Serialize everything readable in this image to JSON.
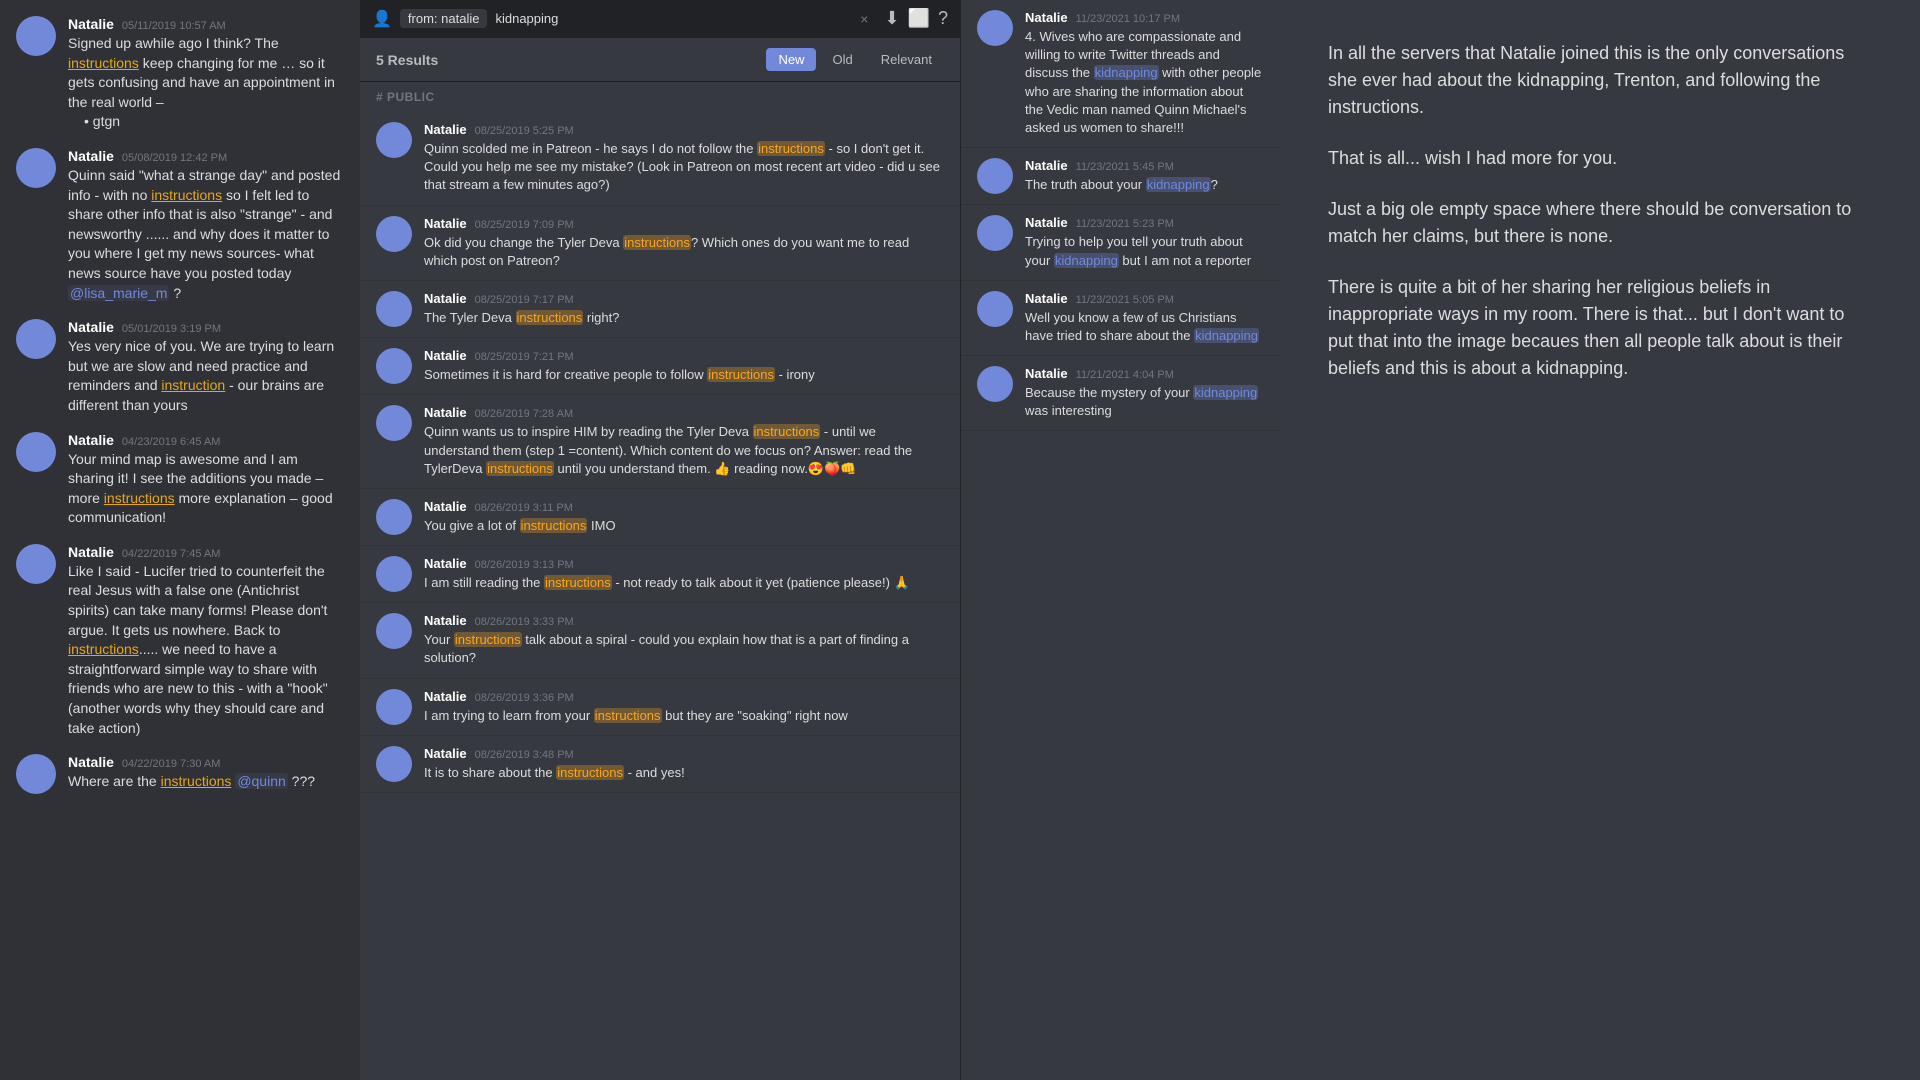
{
  "left_panel": {
    "messages": [
      {
        "id": "msg1",
        "username": "Natalie",
        "timestamp": "05/11/2019 10:57 AM",
        "text": "Signed up awhile ago I think?  The instructions keep changing for me … so it gets confusing and have an appointment in the real world –",
        "bullet": "gtgn",
        "highlight_words": [
          "instructions"
        ]
      },
      {
        "id": "msg2",
        "username": "Natalie",
        "timestamp": "05/08/2019 12:42 PM",
        "text": "Quinn said \"what a strange day\" and posted info - with no instructions so I felt led to share other info that is also \"strange\" - and newsworthy ...... and why does it matter to you where I get my news sources- what news source have you posted today @lisa_marie_m ?",
        "highlight_words": [
          "instructions"
        ]
      },
      {
        "id": "msg3",
        "username": "Natalie",
        "timestamp": "05/01/2019 3:19 PM",
        "text": "Yes very nice of you.  We are trying to learn but we are slow and need practice and reminders and instruction - our brains are different than yours",
        "highlight_words": [
          "instruction"
        ]
      },
      {
        "id": "msg4",
        "username": "Natalie",
        "timestamp": "04/23/2019 6:45 AM",
        "text": "Your mind map is awesome and I am sharing it!  I see the additions you made – more instructions more explanation – good communication!",
        "highlight_words": [
          "instructions"
        ]
      },
      {
        "id": "msg5",
        "username": "Natalie",
        "timestamp": "04/22/2019 7:45 AM",
        "text": "Like I said - Lucifer tried to counterfeit the real Jesus with a false one (Antichrist spirits) can take many forms!  Please don't argue.  It gets us nowhere.  Back to instructions..... we need to have a straightforward simple way to share with friends who are new to this - with a \"hook\" (another words why they should care and take action)",
        "highlight_words": [
          "instructions"
        ]
      },
      {
        "id": "msg6",
        "username": "Natalie",
        "timestamp": "04/22/2019 7:30 AM",
        "text": "Where are the instructions @quinn ???",
        "highlight_words": [
          "instructions"
        ]
      }
    ]
  },
  "search": {
    "from_label": "from: natalie",
    "keyword": "kidnapping",
    "results_count": "5 Results",
    "filters": [
      {
        "label": "New",
        "active": true
      },
      {
        "label": "Old",
        "active": false
      },
      {
        "label": "Relevant",
        "active": false
      }
    ],
    "channel_section": "# public",
    "close_icon": "×",
    "download_icon": "⬇",
    "screen_icon": "⬜",
    "help_icon": "?"
  },
  "search_results": [
    {
      "id": "r1",
      "username": "Natalie",
      "timestamp": "11/23/2021 10:17 PM",
      "text": "4. Wives who are compassionate and willing to write Twitter threads and discuss the kidnapping with other people who are sharing the information about the Vedic man named Quinn Michael's asked us women to share!!!",
      "keyword": "kidnapping"
    },
    {
      "id": "r2",
      "username": "Natalie",
      "timestamp": "11/23/2021 5:45 PM",
      "text": "The truth about your kidnapping?",
      "keyword": "kidnapping"
    },
    {
      "id": "r3",
      "username": "Natalie",
      "timestamp": "11/23/2021 5:23 PM",
      "text": "Trying to help you tell your truth about your kidnapping but I am not a reporter",
      "keyword": "kidnapping"
    },
    {
      "id": "r4",
      "username": "Natalie",
      "timestamp": "11/23/2021 5:05 PM",
      "text": "Well you know a few of us Christians have tried to share about the kidnapping",
      "keyword": "kidnapping"
    },
    {
      "id": "r5",
      "username": "Natalie",
      "timestamp": "11/21/2021 4:04 PM",
      "text": "Because the mystery of your kidnapping was interesting",
      "keyword": "kidnapping"
    }
  ],
  "left_search_results": [
    {
      "id": "ls1",
      "username": "Natalie",
      "timestamp": "08/25/2019 5:25 PM",
      "text_parts": [
        {
          "text": "Quinn scolded me in Patreon - he says I do not follow the ",
          "highlight": false
        },
        {
          "text": "instructions",
          "highlight": true,
          "color": "yellow"
        },
        {
          "text": " - so I don't get it.  Could you help me see my mistake? (Look in Patreon on most recent art video - did u see that stream a few minutes ago?)",
          "highlight": false
        }
      ]
    },
    {
      "id": "ls2",
      "username": "Natalie",
      "timestamp": "08/25/2019 7:09 PM",
      "text_parts": [
        {
          "text": "Ok did you change the Tyler Deva ",
          "highlight": false
        },
        {
          "text": "instructions",
          "highlight": true,
          "color": "yellow"
        },
        {
          "text": "? Which ones do you want me to read  which post on Patreon?",
          "highlight": false
        }
      ]
    },
    {
      "id": "ls3",
      "username": "Natalie",
      "timestamp": "08/25/2019 7:17 PM",
      "text_parts": [
        {
          "text": "The Tyler Deva ",
          "highlight": false
        },
        {
          "text": "instructions",
          "highlight": true,
          "color": "yellow"
        },
        {
          "text": " right?",
          "highlight": false
        }
      ]
    },
    {
      "id": "ls4",
      "username": "Natalie",
      "timestamp": "08/25/2019 7:21 PM",
      "text_parts": [
        {
          "text": "Sometimes it is hard for creative people to follow ",
          "highlight": false
        },
        {
          "text": "instructions",
          "highlight": true,
          "color": "yellow"
        },
        {
          "text": " - irony",
          "highlight": false
        }
      ]
    },
    {
      "id": "ls5",
      "username": "Natalie",
      "timestamp": "08/26/2019 7:28 AM",
      "text_parts": [
        {
          "text": "Quinn wants us to inspire HIM by reading the Tyler Deva ",
          "highlight": false
        },
        {
          "text": "instructions",
          "highlight": true,
          "color": "yellow"
        },
        {
          "text": " - until we understand them (step 1 =content). Which content do we focus on?  Answer: read the TylerDeva ",
          "highlight": false
        },
        {
          "text": "instructions",
          "highlight": true,
          "color": "yellow"
        },
        {
          "text": " until you understand them. 👍 reading now.😍🍑👊",
          "highlight": false
        }
      ]
    },
    {
      "id": "ls6",
      "username": "Natalie",
      "timestamp": "08/26/2019 3:11 PM",
      "text_parts": [
        {
          "text": "You give a lot of ",
          "highlight": false
        },
        {
          "text": "instructions",
          "highlight": true,
          "color": "yellow"
        },
        {
          "text": " IMO",
          "highlight": false
        }
      ]
    },
    {
      "id": "ls7",
      "username": "Natalie",
      "timestamp": "08/26/2019 3:13 PM",
      "text_parts": [
        {
          "text": "I am still reading the ",
          "highlight": false
        },
        {
          "text": "instructions",
          "highlight": true,
          "color": "yellow"
        },
        {
          "text": " - not ready to talk about it yet (patience please!) 🙏",
          "highlight": false
        }
      ]
    },
    {
      "id": "ls8",
      "username": "Natalie",
      "timestamp": "08/26/2019 3:33 PM",
      "text_parts": [
        {
          "text": "Your ",
          "highlight": false
        },
        {
          "text": "instructions",
          "highlight": true,
          "color": "yellow"
        },
        {
          "text": " talk about a spiral - could you explain how that is a part of finding a solution?",
          "highlight": false
        }
      ]
    },
    {
      "id": "ls9",
      "username": "Natalie",
      "timestamp": "08/26/2019 3:36 PM",
      "text_parts": [
        {
          "text": "I am trying to learn from your ",
          "highlight": false
        },
        {
          "text": "instructions",
          "highlight": true,
          "color": "yellow"
        },
        {
          "text": " but they are \"soaking\" right now",
          "highlight": false
        }
      ]
    },
    {
      "id": "ls10",
      "username": "Natalie",
      "timestamp": "08/26/2019 3:48 PM",
      "text_parts": [
        {
          "text": "It is to share about the ",
          "highlight": false
        },
        {
          "text": "instructions",
          "highlight": true,
          "color": "yellow"
        },
        {
          "text": " - and yes!",
          "highlight": false
        }
      ]
    }
  ],
  "right_panel": {
    "paragraphs": [
      "In all the servers that Natalie joined this is the only conversations she ever had about the kidnapping, Trenton, and following the instructions.",
      "That is all... wish I had more for you.",
      "Just a big ole empty space where there should be conversation to match her claims, but there is none.",
      "There is quite a bit of her sharing her religious beliefs in inappropriate ways in my room. There is that... but I don't want to put that into the image becaues then all people talk about is their beliefs and this is about a kidnapping."
    ]
  }
}
